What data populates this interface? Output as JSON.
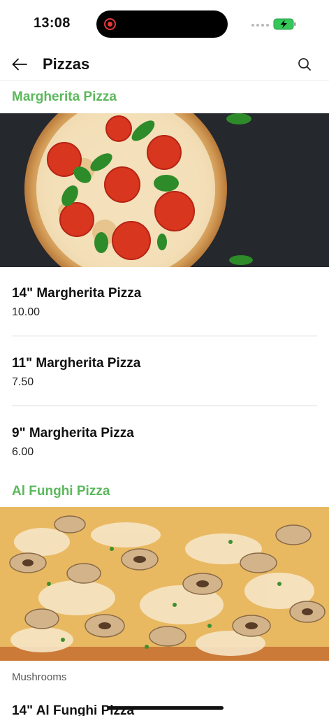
{
  "status_bar": {
    "time": "13:08"
  },
  "header": {
    "title": "Pizzas"
  },
  "sections": [
    {
      "title": "Margherita Pizza",
      "image": "margherita-pizza-photo",
      "items": [
        {
          "name": "14\" Margherita Pizza",
          "price": "10.00"
        },
        {
          "name": "11\" Margherita Pizza",
          "price": "7.50"
        },
        {
          "name": "9\" Margherita Pizza",
          "price": "6.00"
        }
      ]
    },
    {
      "title": "Al Funghi Pizza",
      "image": "al-funghi-pizza-photo",
      "description": "Mushrooms",
      "items": [
        {
          "name": "14\" Al Funghi Pizza"
        }
      ]
    }
  ],
  "colors": {
    "accent": "#5cb85c",
    "battery": "#34c759"
  },
  "icons": [
    "back-arrow-icon",
    "search-icon",
    "battery-icon",
    "recording-icon"
  ]
}
